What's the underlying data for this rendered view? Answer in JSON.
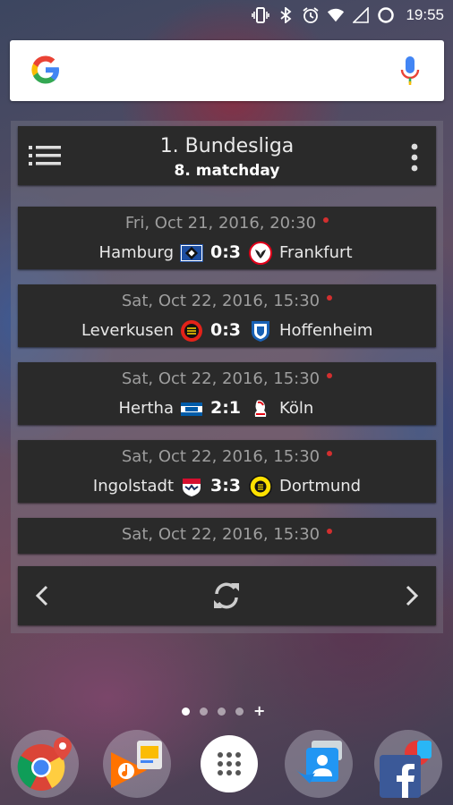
{
  "status_bar": {
    "time": "19:55",
    "icons": [
      "vibrate-icon",
      "bluetooth-icon",
      "alarm-icon",
      "wifi-icon",
      "signal-icon",
      "battery-icon"
    ]
  },
  "search_widget": {
    "logo": "google-logo",
    "mic_icon": "mic-icon"
  },
  "widget": {
    "menu_icon": "list-menu-icon",
    "title": "1. Bundesliga",
    "subtitle": "8. matchday",
    "more_icon": "more-vert-icon",
    "matches": [
      {
        "date": "Fri, Oct 21, 2016, 20:30",
        "home": "Hamburg",
        "score": "0:3",
        "away": "Frankfurt",
        "home_logo": "hamburg-logo",
        "away_logo": "frankfurt-logo"
      },
      {
        "date": "Sat, Oct 22, 2016, 15:30",
        "home": "Leverkusen",
        "score": "0:3",
        "away": "Hoffenheim",
        "home_logo": "leverkusen-logo",
        "away_logo": "hoffenheim-logo"
      },
      {
        "date": "Sat, Oct 22, 2016, 15:30",
        "home": "Hertha",
        "score": "2:1",
        "away": "Köln",
        "home_logo": "hertha-logo",
        "away_logo": "koeln-logo"
      },
      {
        "date": "Sat, Oct 22, 2016, 15:30",
        "home": "Ingolstadt",
        "score": "3:3",
        "away": "Dortmund",
        "home_logo": "ingolstadt-logo",
        "away_logo": "dortmund-logo"
      },
      {
        "date": "Sat, Oct 22, 2016, 15:30"
      }
    ],
    "nav": {
      "prev_icon": "chevron-left-icon",
      "refresh_icon": "refresh-icon",
      "next_icon": "chevron-right-icon"
    }
  },
  "home_pages": {
    "count": 4,
    "active_index": 0,
    "add_label": "+"
  },
  "dock": {
    "apps": [
      "chrome-folder-icon",
      "google-play-music-folder-icon",
      "app-drawer-icon",
      "contacts-folder-icon",
      "facebook-folder-icon"
    ]
  },
  "colors": {
    "card_bg": "#2a2a2a",
    "live_dot": "#d32f2f",
    "date_text": "#9e9e9e"
  }
}
